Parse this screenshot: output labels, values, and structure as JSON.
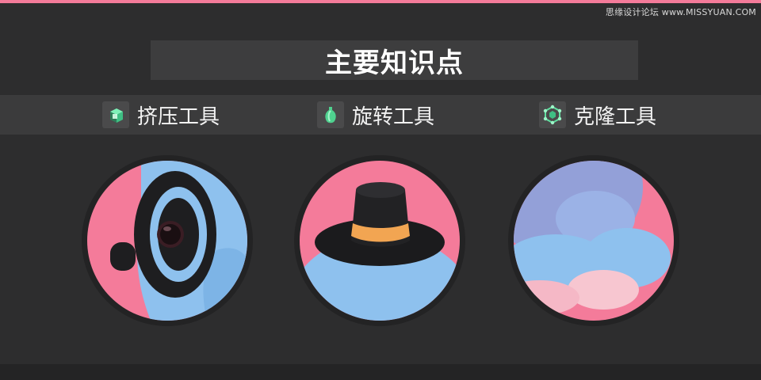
{
  "watermark": "思缘设计论坛 www.MISSYUAN.COM",
  "title": "主要知识点",
  "tools": [
    {
      "label": "挤压工具",
      "icon": "extrude-cube-icon"
    },
    {
      "label": "旋转工具",
      "icon": "lathe-vase-icon"
    },
    {
      "label": "克隆工具",
      "icon": "cloner-icon"
    }
  ],
  "images": [
    {
      "name": "extrude-illustration"
    },
    {
      "name": "lathe-hat-illustration"
    },
    {
      "name": "cloner-spheres-illustration"
    }
  ],
  "colors": {
    "accent_pink": "#f47b9a",
    "blue": "#8ec1ee",
    "icon_green": "#5fe0a0",
    "background": "#2d2d2e"
  }
}
